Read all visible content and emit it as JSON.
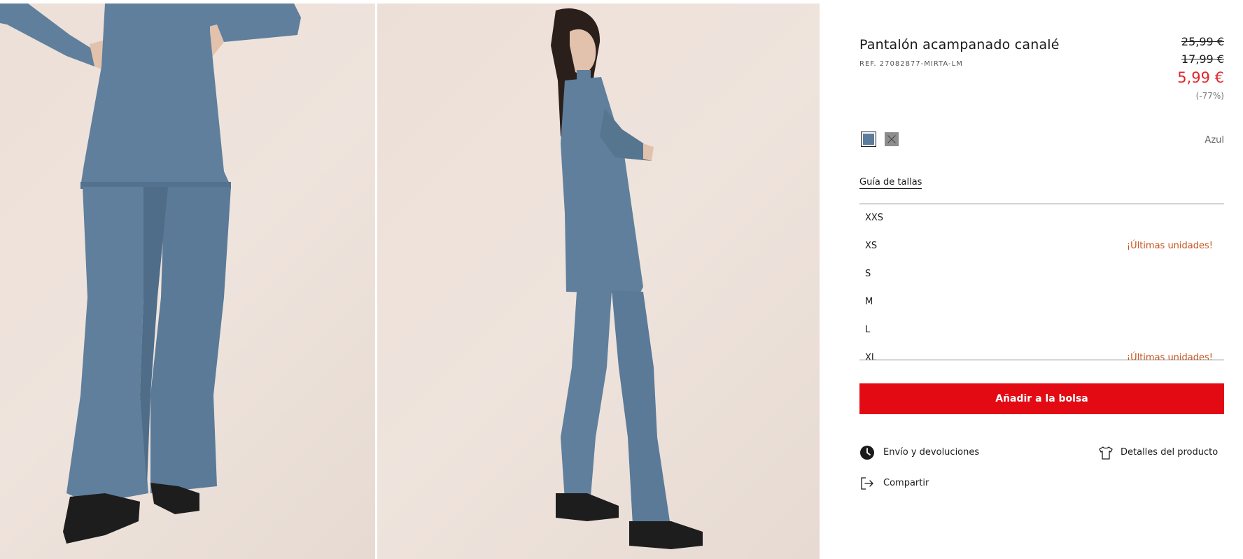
{
  "product": {
    "title": "Pantalón acampanado canalé",
    "ref": "REF. 27082877-MIRTA-LM",
    "price_original": "25,99 €",
    "price_previous": "17,99 €",
    "price_current": "5,99 €",
    "discount": "(-77%)",
    "accent_color": "#e0262b"
  },
  "colors": {
    "selected_name": "Azul",
    "swatches": [
      {
        "name": "blue",
        "hex": "#5c7c9b",
        "selected": true,
        "available": true
      },
      {
        "name": "grey",
        "hex": "#8d8d8d",
        "selected": false,
        "available": false
      }
    ]
  },
  "size_guide_label": "Guía de tallas",
  "sizes": [
    {
      "label": "XXS",
      "note": ""
    },
    {
      "label": "XS",
      "note": "¡Últimas unidades!"
    },
    {
      "label": "S",
      "note": ""
    },
    {
      "label": "M",
      "note": ""
    },
    {
      "label": "L",
      "note": ""
    },
    {
      "label": "XL",
      "note": "¡Últimas unidades!"
    }
  ],
  "add_to_bag_label": "Añadir a la bolsa",
  "actions": {
    "shipping": {
      "label": "Envío y devoluciones",
      "icon": "clock-icon"
    },
    "details": {
      "label": "Detalles del producto",
      "icon": "tshirt-icon"
    },
    "share": {
      "label": "Compartir",
      "icon": "share-icon"
    }
  },
  "gallery": {
    "garment_color": "#5f7f9c",
    "background_color": "#ecdfd7"
  }
}
